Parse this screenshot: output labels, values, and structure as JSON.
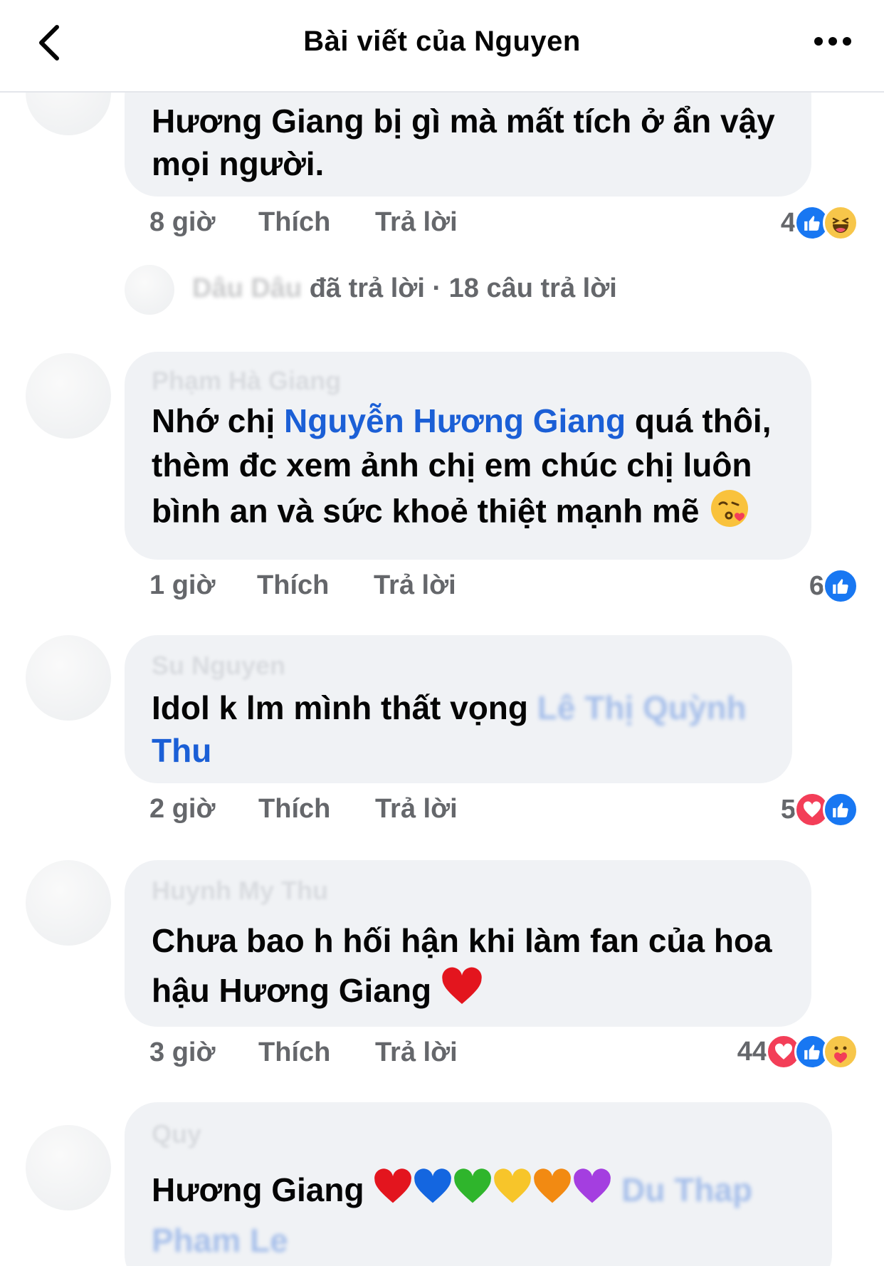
{
  "header": {
    "title": "Bài viết của Nguyen"
  },
  "comments": [
    {
      "text": "Hương Giang bị gì mà mất tích ở ẩn vậy mọi người.",
      "time": "8 giờ",
      "like": "Thích",
      "reply": "Trả lời",
      "reaction_count": "4",
      "reactions": [
        "like-icon",
        "haha-icon"
      ]
    },
    {
      "replies_prefix": "Dâu Dâu",
      "replies_text": "đã trả lời · 18 câu trả lời"
    },
    {
      "author": "Phạm Hà Giang",
      "text_before": "Nhớ chị ",
      "mention": "Nguyễn Hương Giang",
      "text_after": " quá thôi, thèm đc xem ảnh chị em chúc  chị luôn bình an và sức khoẻ thiệt mạnh mẽ",
      "time": "1 giờ",
      "like": "Thích",
      "reply": "Trả lời",
      "reaction_count": "6",
      "reactions": [
        "like-icon"
      ]
    },
    {
      "author": "Su Nguyen",
      "text_before": "Idol k lm mình thất vọng ",
      "mention_blur": "Lê Thị Quỳnh",
      "mention": "Thu",
      "time": "2 giờ",
      "like": "Thích",
      "reply": "Trả lời",
      "reaction_count": "5",
      "reactions": [
        "love-icon",
        "like-icon"
      ]
    },
    {
      "author": "Huynh My Thu",
      "text": "Chưa bao h hối hận khi làm fan của hoa hậu Hương Giang",
      "time": "3 giờ",
      "like": "Thích",
      "reply": "Trả lời",
      "reaction_count": "44",
      "reactions": [
        "love-icon",
        "like-icon",
        "care-icon"
      ]
    },
    {
      "author": "Quy",
      "text": "Hương Giang",
      "emojis": [
        "red-heart",
        "blue-heart",
        "green-heart",
        "yellow-heart",
        "orange-heart",
        "purple-heart"
      ],
      "mention_blur": "Du Thap",
      "mention_blur2": "Pham Le"
    }
  ],
  "colors": {
    "accent": "#1877f2",
    "mention": "#1b5fd6",
    "bubble": "#f0f2f5",
    "meta": "#65676b"
  }
}
